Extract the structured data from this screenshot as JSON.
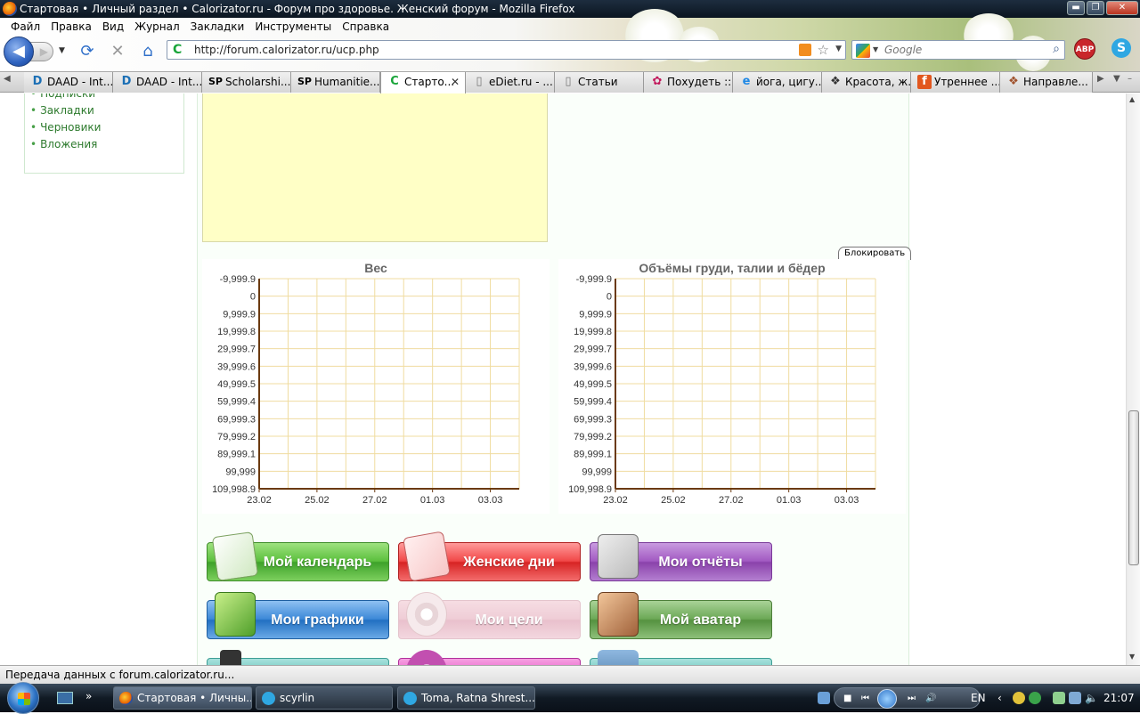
{
  "window": {
    "title": "Стартовая • Личный раздел • Calorizator.ru - Форум про здоровье. Женский форум - Mozilla Firefox",
    "min": "▬",
    "max": "❐",
    "close": "✕"
  },
  "menu": [
    "Файл",
    "Правка",
    "Вид",
    "Журнал",
    "Закладки",
    "Инструменты",
    "Справка"
  ],
  "nav": {
    "url": "http://forum.calorizator.ru/ucp.php",
    "search_placeholder": "Google",
    "abp": "ABP"
  },
  "tabs": [
    {
      "icon": "D",
      "label": "DAAD - Int..."
    },
    {
      "icon": "D",
      "label": "DAAD - Int..."
    },
    {
      "icon": "SP",
      "label": "Scholarshi..."
    },
    {
      "icon": "SP",
      "label": "Humanitie..."
    },
    {
      "icon": "C",
      "label": "Старто...",
      "active": true
    },
    {
      "icon": "▯",
      "label": "eDiet.ru - ..."
    },
    {
      "icon": "▯",
      "label": "Статьи"
    },
    {
      "icon": "✿",
      "label": "Похудеть ::..."
    },
    {
      "icon": "e",
      "label": "йога, цигу..."
    },
    {
      "icon": "❖",
      "label": "Красота, ж..."
    },
    {
      "icon": "f",
      "label": "Утреннее ..."
    },
    {
      "icon": "❖",
      "label": "Направле..."
    }
  ],
  "sidebar": {
    "items": [
      "Подписки",
      "Закладки",
      "Черновики",
      "Вложения"
    ]
  },
  "block_button": "Блокировать",
  "charts": {
    "ticks_y": [
      "-9,999.9",
      "0",
      "9,999.9",
      "19,999.8",
      "29,999.7",
      "39,999.6",
      "49,999.5",
      "59,999.4",
      "69,999.3",
      "79,999.2",
      "89,999.1",
      "99,999",
      "109,998.9"
    ],
    "ticks_x": [
      "23.02",
      "25.02",
      "27.02",
      "01.03",
      "03.03"
    ]
  },
  "chart_data": [
    {
      "type": "line",
      "title": "Вес",
      "categories": [
        "23.02",
        "25.02",
        "27.02",
        "01.03",
        "03.03"
      ],
      "series": [],
      "ylim": [
        -9999.9,
        109998.9
      ],
      "y_inverted": true,
      "grid": true,
      "grid_color": "#f0dca0",
      "axis_color": "#6b3a10"
    },
    {
      "type": "line",
      "title": "Объёмы груди, талии и бёдер",
      "categories": [
        "23.02",
        "25.02",
        "27.02",
        "01.03",
        "03.03"
      ],
      "series": [],
      "ylim": [
        -9999.9,
        109998.9
      ],
      "y_inverted": true,
      "grid": true,
      "grid_color": "#f0dca0",
      "axis_color": "#6b3a10"
    }
  ],
  "buttons": {
    "calendar": "Мой календарь",
    "women_days": "Женские дни",
    "reports": "Мои отчёты",
    "graphs": "Мои графики",
    "goals": "Мои цели",
    "avatar": "Мой аватар"
  },
  "status": "Передача данных с forum.calorizator.ru...",
  "taskbar": {
    "items": [
      {
        "label": "Стартовая • Личны...",
        "active": true
      },
      {
        "label": "scyrlin"
      },
      {
        "label": "Toma, Ratna Shrest..."
      }
    ],
    "lang": "EN",
    "time": "21:07",
    "media": {
      "stop": "■",
      "prev": "⏮",
      "next": "⏭",
      "vol": "🔊"
    }
  }
}
